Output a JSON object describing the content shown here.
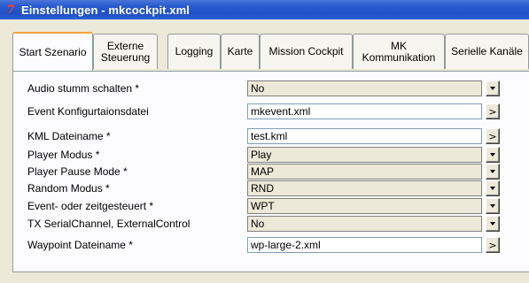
{
  "window": {
    "title": "Einstellungen - mkcockpit.xml",
    "icon": "app-logo-icon",
    "icon_text": "7"
  },
  "tabs": [
    {
      "label": "Start Szenario",
      "active": true
    },
    {
      "label": "Externe Steuerung"
    },
    {
      "label": "Logging"
    },
    {
      "label": "Karte"
    },
    {
      "label": "Mission Cockpit"
    },
    {
      "label": "MK Kommunikation"
    },
    {
      "label": "Serielle Kanäle"
    }
  ],
  "settings": [
    {
      "label": "Audio stumm schalten *",
      "value": "No",
      "control": "dropdown"
    },
    {
      "label": "Event Konfigurtaionsdatei",
      "value": "mkevent.xml",
      "control": "browse"
    },
    {
      "label": "KML Dateiname *",
      "value": "test.kml",
      "control": "browse"
    },
    {
      "label": "Player Modus *",
      "value": "Play",
      "control": "dropdown"
    },
    {
      "label": "Player Pause Mode *",
      "value": "MAP",
      "control": "dropdown"
    },
    {
      "label": "Random Modus *",
      "value": "RND",
      "control": "dropdown"
    },
    {
      "label": "Event- oder zeitgesteuert *",
      "value": "WPT",
      "control": "dropdown"
    },
    {
      "label": "TX SerialChannel, ExternalControl",
      "value": "No",
      "control": "dropdown"
    },
    {
      "label": "Waypoint Dateiname *",
      "value": "wp-large-2.xml",
      "control": "browse"
    }
  ],
  "browse_button_label": ">",
  "colors": {
    "titlebar": "#2a5bd0",
    "active_tab_accent": "#f1a33b",
    "dialog_bg": "#ece9d8"
  }
}
